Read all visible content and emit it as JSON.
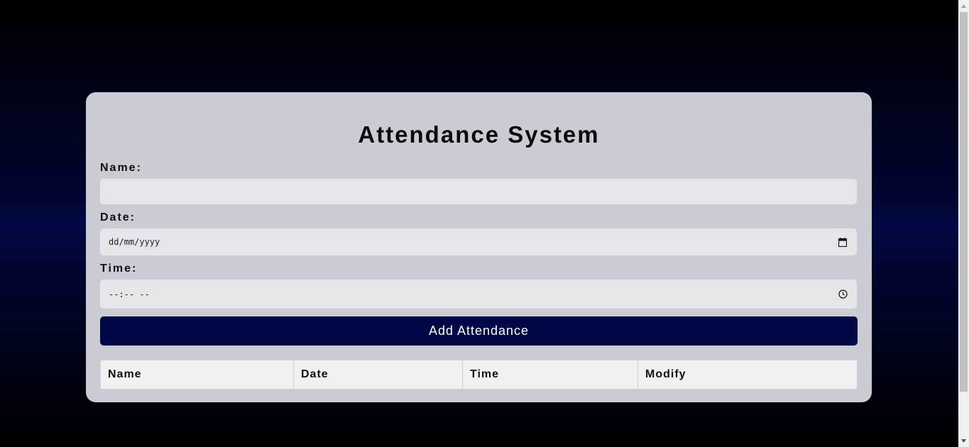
{
  "app": {
    "title": "Attendance System"
  },
  "form": {
    "name_label": "Name:",
    "name_value": "",
    "date_label": "Date:",
    "date_placeholder": "dd/mm/yyyy",
    "time_label": "Time:",
    "time_placeholder": "--:-- --",
    "submit_label": "Add Attendance"
  },
  "table": {
    "headers": [
      "Name",
      "Date",
      "Time",
      "Modify"
    ],
    "rows": []
  },
  "icons": {
    "date": "calendar-icon",
    "time": "clock-icon"
  },
  "colors": {
    "button_bg": "#000646",
    "card_bg": "#cacbd3"
  }
}
